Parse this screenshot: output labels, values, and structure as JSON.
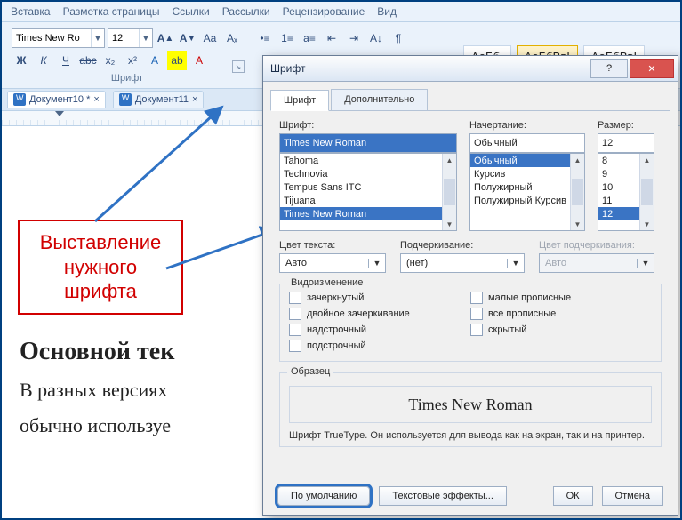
{
  "ribbon": {
    "tabs": [
      "Вставка",
      "Разметка страницы",
      "Ссылки",
      "Рассылки",
      "Рецензирование",
      "Вид"
    ],
    "font_name": "Times New Ro",
    "font_size": "12",
    "group_font": "Шрифт",
    "bold": "Ж",
    "italic": "К",
    "underline": "Ч",
    "styles": [
      {
        "label": "АаБб.",
        "active": false
      },
      {
        "label": "АаБбВвІ",
        "active": true
      },
      {
        "label": "АаБбВвІ",
        "active": false
      }
    ]
  },
  "docs": [
    {
      "name": "Документ10 *",
      "active": true
    },
    {
      "name": "Документ11",
      "active": false
    }
  ],
  "callout": "Выставление нужного шрифта",
  "body_heading": "Основной тек",
  "body_line1": "В разных версиях",
  "body_line2": "обычно используе",
  "dialog": {
    "title": "Шрифт",
    "tabs": {
      "font": "Шрифт",
      "advanced": "Дополнительно"
    },
    "labels": {
      "font": "Шрифт:",
      "style": "Начертание:",
      "size": "Размер:",
      "text_color": "Цвет текста:",
      "underline": "Подчеркивание:",
      "underline_color": "Цвет подчеркивания:",
      "effects": "Видоизменение",
      "sample": "Образец"
    },
    "font_value": "Times New Roman",
    "font_list": [
      "Tahoma",
      "Technovia",
      "Tempus Sans ITC",
      "Tijuana",
      "Times New Roman"
    ],
    "style_value": "Обычный",
    "style_list": [
      "Обычный",
      "Курсив",
      "Полужирный",
      "Полужирный Курсив"
    ],
    "size_value": "12",
    "size_list": [
      "8",
      "9",
      "10",
      "11",
      "12"
    ],
    "text_color_value": "Авто",
    "underline_value": "(нет)",
    "underline_color_value": "Авто",
    "effects_left": [
      "зачеркнутый",
      "двойное зачеркивание",
      "надстрочный",
      "подстрочный"
    ],
    "effects_right": [
      "малые прописные",
      "все прописные",
      "скрытый"
    ],
    "sample_text": "Times New Roman",
    "note": "Шрифт TrueType. Он используется для вывода как на экран, так и на принтер.",
    "buttons": {
      "default": "По умолчанию",
      "text_effects": "Текстовые эффекты...",
      "ok": "ОК",
      "cancel": "Отмена"
    }
  }
}
